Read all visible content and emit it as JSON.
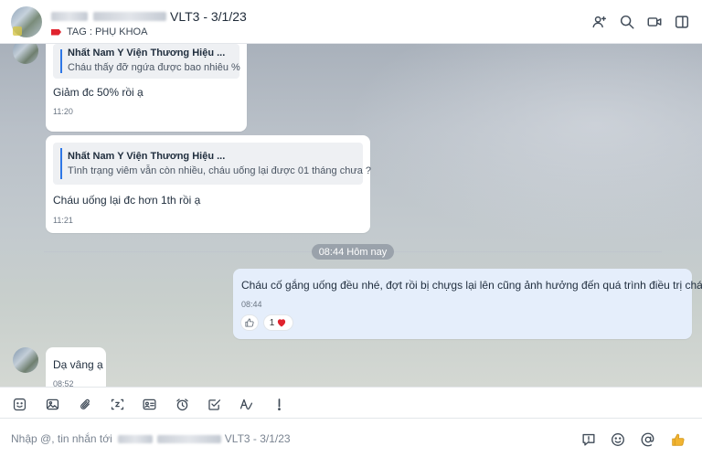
{
  "header": {
    "title_suffix": "VLT3 - 3/1/23",
    "tag_label": "TAG : PHỤ KHOA"
  },
  "messages": [
    {
      "quote_author": "Nhất Nam Y Viện Thương Hiệu ...",
      "quote_text": "Cháu thấy đỡ ngứa được bao nhiêu %",
      "text": "Giảm đc 50% rồi ạ",
      "time": "11:20"
    },
    {
      "quote_author": "Nhất Nam Y Viện Thương Hiệu ...",
      "quote_text": "Tình trạng viêm vẫn còn nhiều, cháu uống lại được 01 tháng chưa ?",
      "text": "Cháu uống lại đc hơn 1th rồi ạ",
      "time": "11:21"
    }
  ],
  "separator": "08:44 Hôm nay",
  "my_message": {
    "text": "Cháu cố gắng uống đều nhé, đợt rồi bị chựgs lại lên cũng ảnh hưởng đến quá trình điều trị cháu ạ",
    "time": "08:44",
    "reaction_count": "1"
  },
  "last_message": {
    "text": "Dạ vâng ạ",
    "time": "08:52"
  },
  "composer": {
    "placeholder_prefix": "Nhập @, tin nhắn tới",
    "placeholder_suffix": "VLT3 - 3/1/23"
  },
  "icons": {
    "header": [
      "add-member-icon",
      "search-icon",
      "video-call-icon",
      "sidebar-toggle-icon"
    ],
    "toolbar": [
      "sticker-icon",
      "image-icon",
      "attachment-icon",
      "screenshot-icon",
      "contact-card-icon",
      "reminder-icon",
      "task-icon",
      "format-text-icon",
      "important-icon"
    ],
    "input": [
      "quick-message-icon",
      "emoji-icon",
      "mention-icon",
      "thumbs-up-icon"
    ]
  },
  "colors": {
    "accent": "#2e77e6",
    "tag": "#e0232e",
    "heart": "#e0232e",
    "thumb": "#f2b431",
    "my_bubble": "#e5eefb"
  }
}
